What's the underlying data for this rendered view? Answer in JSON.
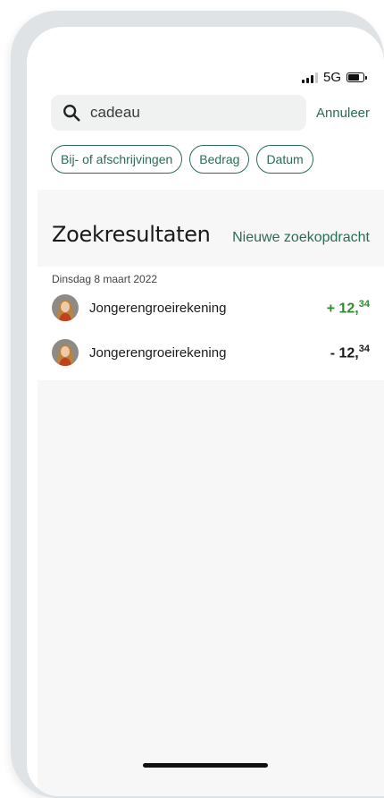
{
  "status_bar": {
    "network": "5G",
    "signal_icon": "signal-bars-icon",
    "battery_icon": "battery-icon"
  },
  "search": {
    "value": "cadeau",
    "icon": "search-icon",
    "cancel_label": "Annuleer"
  },
  "filters": [
    {
      "label": "Bij- of afschrijvingen"
    },
    {
      "label": "Bedrag"
    },
    {
      "label": "Datum"
    }
  ],
  "results": {
    "title": "Zoekresultaten",
    "new_search_label": "Nieuwe zoekopdracht",
    "groups": [
      {
        "date": "Dinsdag 8 maart 2022",
        "transactions": [
          {
            "name": "Jongerengroeirekening",
            "sign": "+",
            "whole": "12",
            "cents": "34",
            "type": "positive"
          },
          {
            "name": "Jongerengroeirekening",
            "sign": "-",
            "whole": "12",
            "cents": "34",
            "type": "negative"
          }
        ]
      }
    ]
  },
  "colors": {
    "accent": "#2b6c55",
    "positive": "#2f8a2f",
    "background": "#f7f7f7"
  }
}
